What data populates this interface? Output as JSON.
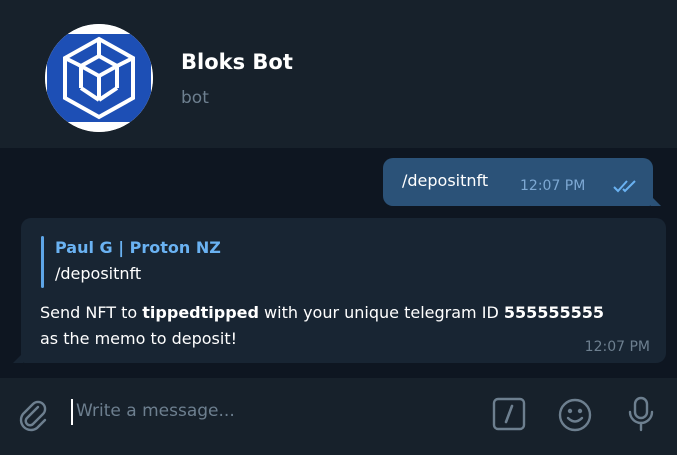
{
  "header": {
    "bot_name": "Bloks Bot",
    "subtitle": "bot",
    "avatar_icon": "cube-logo-icon"
  },
  "messages": {
    "outgoing": {
      "text": "/depositnft",
      "time": "12:07 PM",
      "status_icon": "double-check-icon"
    },
    "incoming": {
      "reply_author": "Paul G | Proton NZ",
      "reply_text": "/depositnft",
      "text_part1": "Send NFT to ",
      "text_bold1": "tippedtipped",
      "text_part2": " with your unique telegram ID ",
      "text_bold2": "555555555",
      "text_part3": "as the memo to deposit!",
      "time": "12:07 PM"
    }
  },
  "composer": {
    "placeholder": "Write a message...",
    "icons": [
      "paperclip-icon",
      "slash-command-icon",
      "emoji-icon",
      "microphone-icon"
    ]
  },
  "colors": {
    "background": "#0e1621",
    "header": "#17212b",
    "outgoing_bubble": "#2b5278",
    "incoming_bubble": "#182533",
    "accent": "#6ab2f2",
    "avatar_blue": "#1d4fb5"
  }
}
